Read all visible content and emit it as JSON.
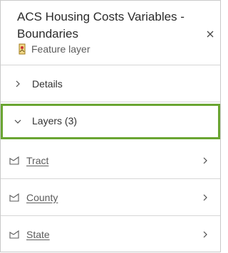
{
  "panel": {
    "title": "ACS Housing Costs Variables - Boundaries",
    "subtitle": "Feature layer",
    "close_label": "×"
  },
  "sections": {
    "details_label": "Details",
    "layers_label": "Layers (3)"
  },
  "layers": [
    {
      "label": "Tract"
    },
    {
      "label": "County"
    },
    {
      "label": "State"
    }
  ],
  "colors": {
    "highlight_border": "#6aa532",
    "divider": "#d6d6d6"
  }
}
